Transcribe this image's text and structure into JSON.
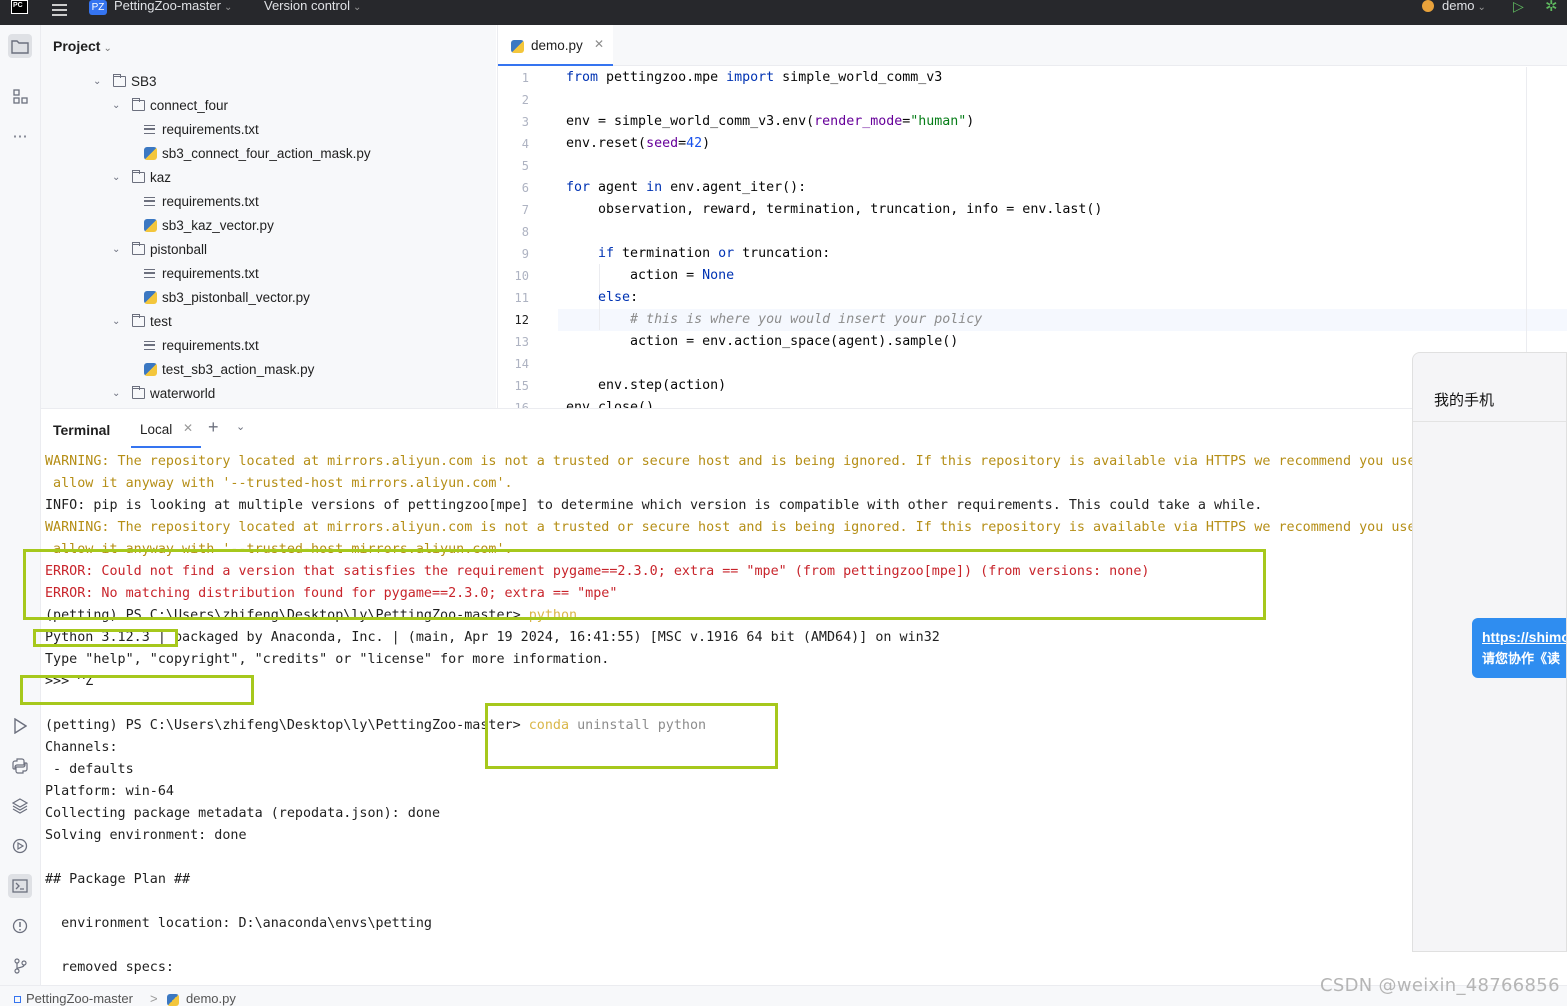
{
  "titlebar": {
    "project_badge": "PZ",
    "project_name": "PettingZoo-master",
    "version_control": "Version control",
    "run_config": "demo"
  },
  "project_panel": {
    "title": "Project",
    "tree": [
      {
        "label": "SB3",
        "type": "folder",
        "depth": 0,
        "expanded": true
      },
      {
        "label": "connect_four",
        "type": "folder",
        "depth": 1,
        "expanded": true
      },
      {
        "label": "requirements.txt",
        "type": "text",
        "depth": 2
      },
      {
        "label": "sb3_connect_four_action_mask.py",
        "type": "python",
        "depth": 2
      },
      {
        "label": "kaz",
        "type": "folder",
        "depth": 1,
        "expanded": true
      },
      {
        "label": "requirements.txt",
        "type": "text",
        "depth": 2
      },
      {
        "label": "sb3_kaz_vector.py",
        "type": "python",
        "depth": 2
      },
      {
        "label": "pistonball",
        "type": "folder",
        "depth": 1,
        "expanded": true
      },
      {
        "label": "requirements.txt",
        "type": "text",
        "depth": 2
      },
      {
        "label": "sb3_pistonball_vector.py",
        "type": "python",
        "depth": 2
      },
      {
        "label": "test",
        "type": "folder",
        "depth": 1,
        "expanded": true
      },
      {
        "label": "requirements.txt",
        "type": "text",
        "depth": 2
      },
      {
        "label": "test_sb3_action_mask.py",
        "type": "python",
        "depth": 2
      },
      {
        "label": "waterworld",
        "type": "folder",
        "depth": 1,
        "expanded": true
      }
    ]
  },
  "editor": {
    "tab_label": "demo.py",
    "current_line": 12,
    "line_numbers": [
      "1",
      "2",
      "3",
      "4",
      "5",
      "6",
      "7",
      "8",
      "9",
      "10",
      "11",
      "12",
      "13",
      "14",
      "15",
      "16"
    ],
    "code": {
      "l1_from": "from",
      "l1_mod": " pettingzoo.mpe ",
      "l1_import": "import",
      "l1_name": " simple_world_comm_v3",
      "l3_a": "env = simple_world_comm_v3.env(",
      "l3_param": "render_mode",
      "l3_eq": "=",
      "l3_str": "\"human\"",
      "l3_close": ")",
      "l4_a": "env.reset(",
      "l4_param": "seed",
      "l4_eq": "=",
      "l4_num": "42",
      "l4_close": ")",
      "l6_for": "for",
      "l6_agent": " agent ",
      "l6_in": "in",
      "l6_rest": " env.agent_iter():",
      "l7": "    observation, reward, termination, truncation, info = env.last()",
      "l9_indent": "    ",
      "l9_if": "if",
      "l9_a": " termination ",
      "l9_or": "or",
      "l9_b": " truncation:",
      "l10_a": "        action = ",
      "l10_none": "None",
      "l11_indent": "    ",
      "l11_else": "else",
      "l11_colon": ":",
      "l12_indent": "        ",
      "l12_comment": "# this is where you would insert your policy",
      "l13": "        action = env.action_space(agent).sample()",
      "l15": "    env.step(action)",
      "l16": "env.close()"
    }
  },
  "terminal": {
    "title": "Terminal",
    "tab_label": "Local",
    "lines": {
      "w1": "WARNING: The repository located at mirrors.aliyun.com is not a trusted or secure host and is being ignored. If this repository is available via HTTPS we recommend you use",
      "w1b": " allow it anyway with '--trusted-host mirrors.aliyun.com'.",
      "info": "INFO: pip is looking at multiple versions of pettingzoo[mpe] to determine which version is compatible with other requirements. This could take a while.",
      "w2": "WARNING: The repository located at mirrors.aliyun.com is not a trusted or secure host and is being ignored. If this repository is available via HTTPS we recommend you use",
      "w2b": " allow it anyway with '--trusted-host mirrors.aliyun.com'.",
      "e1": "ERROR: Could not find a version that satisfies the requirement pygame==2.3.0; extra == \"mpe\" (from pettingzoo[mpe]) (from versions: none)",
      "e2": "ERROR: No matching distribution found for pygame==2.3.0; extra == \"mpe\"",
      "prompt1": "(petting) PS C:\\Users\\zhifeng\\Desktop\\ly\\PettingZoo-master> ",
      "cmd1": "python",
      "py_banner": "Python 3.12.3 | packaged by Anaconda, Inc. | (main, Apr 19 2024, 16:41:55) [MSC v.1916 64 bit (AMD64)] on win32",
      "py_help": "Type \"help\", \"copyright\", \"credits\" or \"license\" for more information.",
      "py_exit": ">>> ^Z",
      "prompt2": "(petting) PS C:\\Users\\zhifeng\\Desktop\\ly\\PettingZoo-master> ",
      "cmd2a": "conda",
      "cmd2b": " uninstall python",
      "channels": "Channels:",
      "defaults": " - defaults",
      "platform": "Platform: win-64",
      "collecting": "Collecting package metadata (repodata.json): done",
      "solving": "Solving environment: done",
      "plan": "## Package Plan ##",
      "envloc": "  environment location: D:\\anaconda\\envs\\petting",
      "removed": "  removed specs:"
    }
  },
  "phone_panel": {
    "title": "我的手机",
    "bubble_link": "https://shimo",
    "bubble_text": "请您协作《读"
  },
  "statusbar": {
    "project": "PettingZoo-master",
    "separator": ">",
    "file": "demo.py"
  },
  "watermark": "CSDN @weixin_48766856",
  "colors": {
    "accent": "#3574f0",
    "warning_text": "#b58e16",
    "error_text": "#c8242b",
    "highlight_box": "#a6c81c",
    "chat_bubble": "#2f8df0"
  }
}
